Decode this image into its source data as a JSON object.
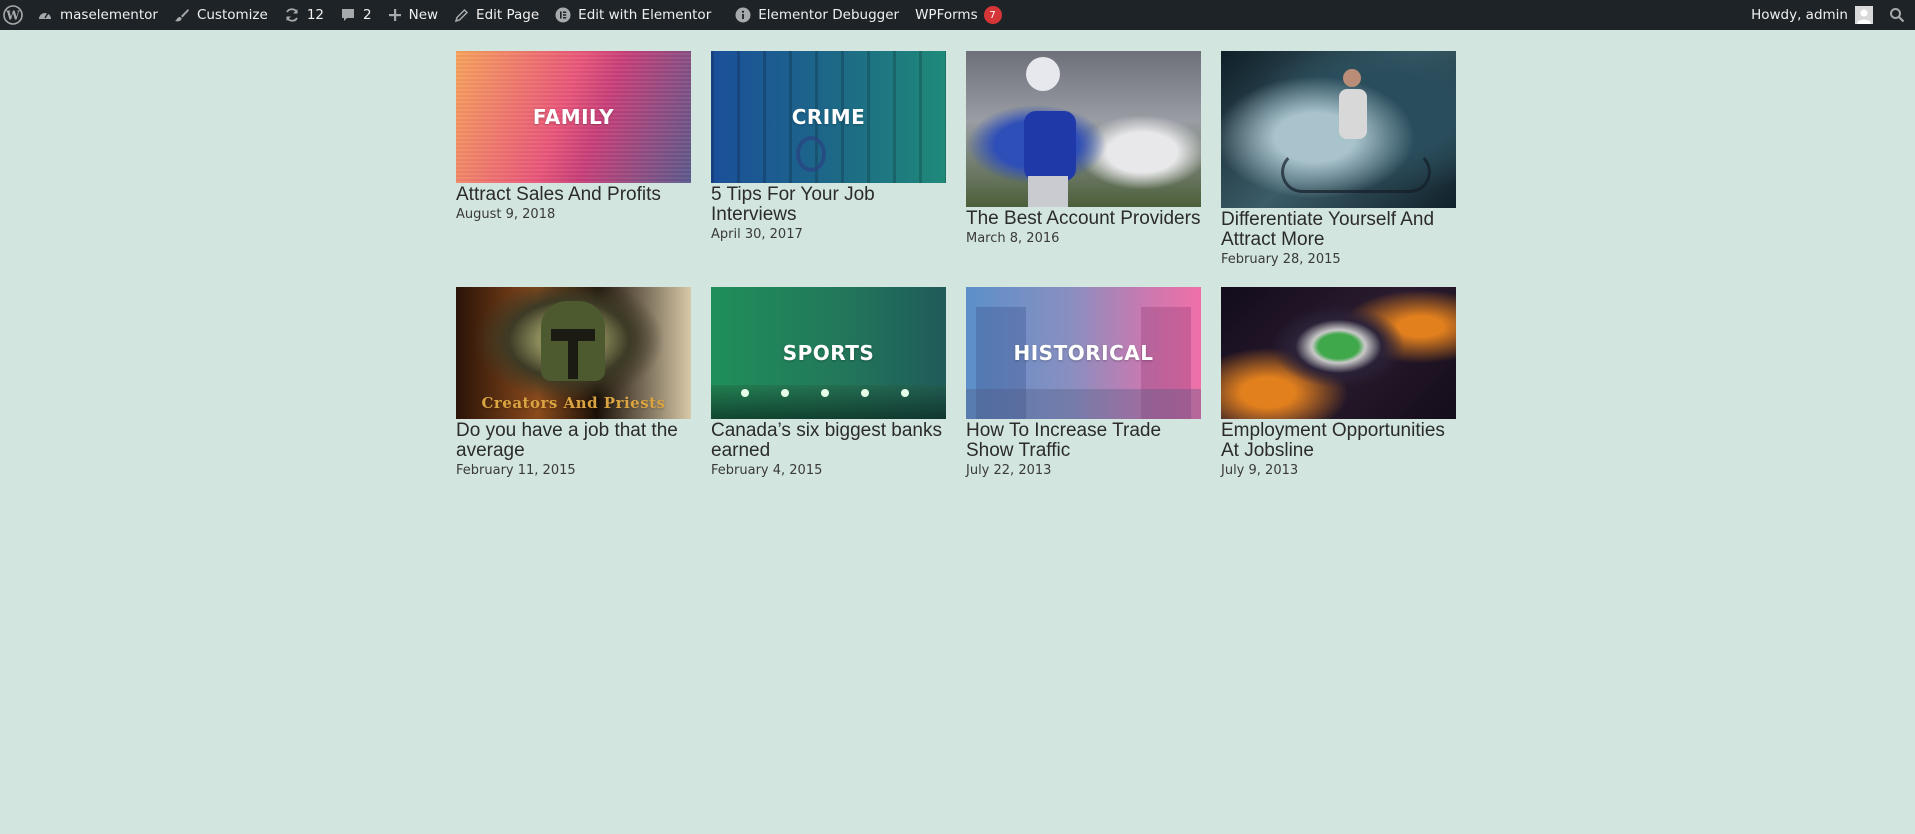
{
  "adminbar": {
    "site_name": "maselementor",
    "customize": "Customize",
    "updates_count": "12",
    "comments_count": "2",
    "new_label": "New",
    "edit_page": "Edit Page",
    "edit_with_elementor": "Edit with Elementor",
    "elementor_debugger": "Elementor Debugger",
    "wpforms": "WPForms",
    "wpforms_badge": "7",
    "howdy": "Howdy, admin"
  },
  "posts": [
    {
      "title": "Attract Sales And Profits",
      "date": "August 9, 2018",
      "thumb_label": "FAMILY"
    },
    {
      "title": "5 Tips For Your Job Interviews",
      "date": "April 30, 2017",
      "thumb_label": "CRIME"
    },
    {
      "title": "The Best Account Providers",
      "date": "March 8, 2016",
      "thumb_label": ""
    },
    {
      "title": "Differentiate Yourself And Attract More",
      "date": "February 28, 2015",
      "thumb_label": ""
    },
    {
      "title": "Do you have a job that the average",
      "date": "February 11, 2015",
      "thumb_label": "Creators And Priests"
    },
    {
      "title": "Canada’s six biggest banks earned",
      "date": "February 4, 2015",
      "thumb_label": "SPORTS"
    },
    {
      "title": "How To Increase Trade Show Traffic",
      "date": "July 22, 2013",
      "thumb_label": "HISTORICAL"
    },
    {
      "title": "Employment Opportunities At Jobsline",
      "date": "July 9, 2013",
      "thumb_label": ""
    }
  ],
  "colors": {
    "page_background": "#d2e5de",
    "adminbar_background": "#1d2327",
    "badge": "#d63638"
  }
}
